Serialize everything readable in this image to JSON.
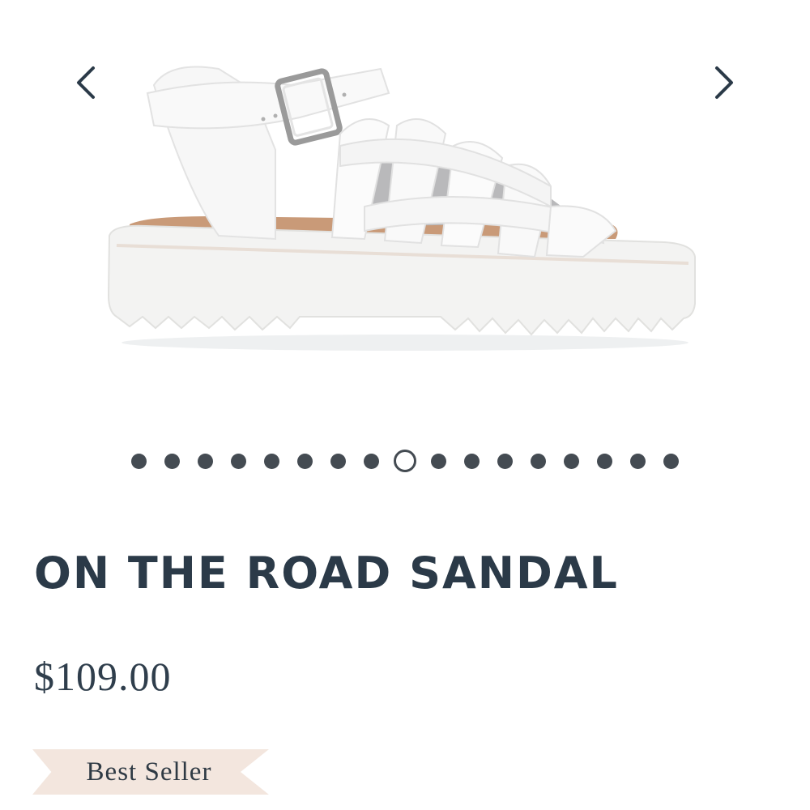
{
  "gallery": {
    "prev_icon": "chevron-left-icon",
    "next_icon": "chevron-right-icon",
    "image_count": 17,
    "active_index": 8
  },
  "product": {
    "title": "ON THE ROAD SANDAL",
    "price": "$109.00",
    "badge": "Best Seller"
  },
  "colors": {
    "text": "#2b3a48",
    "dot": "#444b52",
    "badge_bg": "#f3e6de"
  }
}
